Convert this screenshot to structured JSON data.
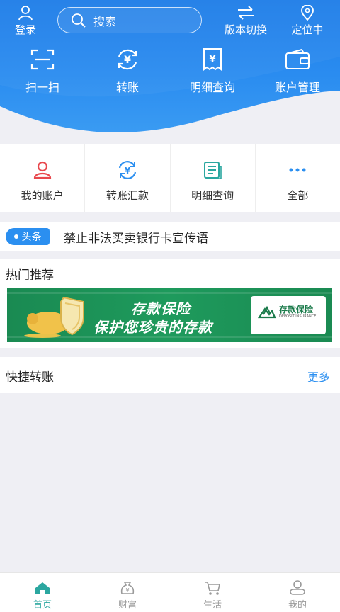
{
  "colors": {
    "header_blue": "#2a8cf0",
    "accent_blue": "#2b8ff0",
    "tab_active": "#2ba7a0",
    "banner_green": "#1a8a52",
    "red_icon": "#e8484d"
  },
  "top_bar": {
    "login_label": "登录",
    "search_placeholder": "搜索",
    "version_label": "版本切换",
    "locate_label": "定位中"
  },
  "quick_actions": [
    {
      "icon": "scan-icon",
      "label": "扫一扫"
    },
    {
      "icon": "transfer-yuan-icon",
      "label": "转账"
    },
    {
      "icon": "receipt-icon",
      "label": "明细查询"
    },
    {
      "icon": "wallet-icon",
      "label": "账户管理"
    }
  ],
  "services": [
    {
      "icon": "user-icon",
      "label": "我的账户"
    },
    {
      "icon": "yuan-exchange-icon",
      "label": "转账汇款"
    },
    {
      "icon": "document-icon",
      "label": "明细查询"
    },
    {
      "icon": "more-dots-icon",
      "label": "全部"
    }
  ],
  "headline": {
    "tag": "头条",
    "text": "禁止非法买卖银行卡宣传语"
  },
  "hot": {
    "title": "热门推荐",
    "banner": {
      "line1": "存款保险",
      "line2": "保护您珍贵的存款",
      "logo_text": "存款保险",
      "logo_sub": "DEPOSIT INSURANCE"
    }
  },
  "fast_transfer": {
    "title": "快捷转账",
    "more": "更多"
  },
  "tabbar": [
    {
      "icon": "home-icon",
      "label": "首页",
      "active": true
    },
    {
      "icon": "money-bag-icon",
      "label": "财富",
      "active": false
    },
    {
      "icon": "cart-icon",
      "label": "生活",
      "active": false
    },
    {
      "icon": "profile-icon",
      "label": "我的",
      "active": false
    }
  ]
}
